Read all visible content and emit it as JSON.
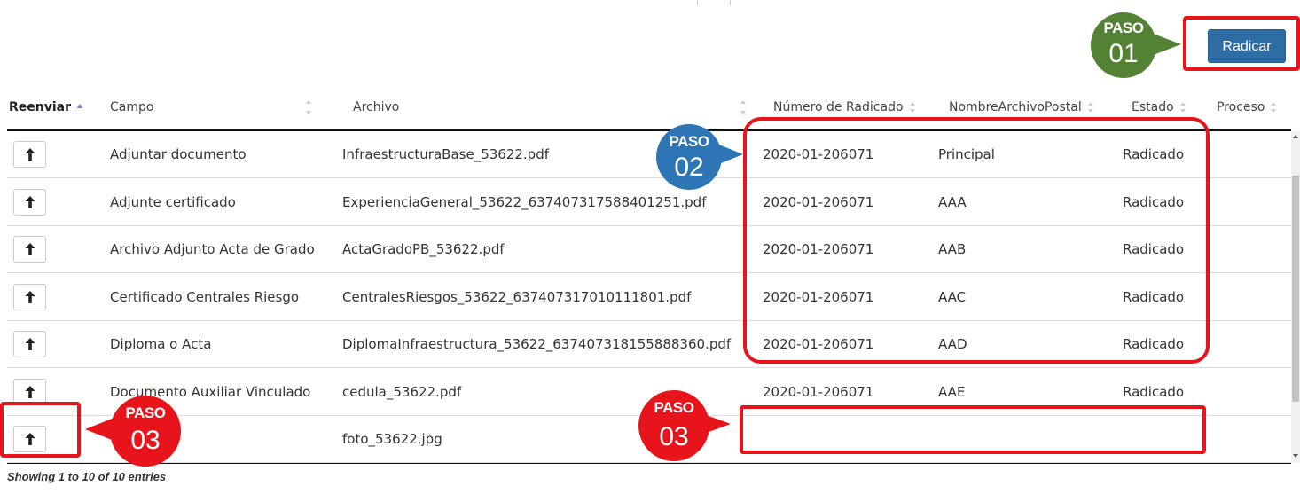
{
  "toolbar": {
    "radicar_label": "Radicar"
  },
  "table": {
    "headers": [
      "Reenviar",
      "Campo",
      "Archivo",
      "Número de Radicado",
      "NombreArchivoPostal",
      "Estado",
      "Proceso"
    ],
    "rows": [
      {
        "campo": "Adjuntar documento",
        "archivo": "InfraestructuraBase_53622.pdf",
        "radicado": "2020-01-206071",
        "postal": "Principal",
        "estado": "Radicado",
        "proceso": ""
      },
      {
        "campo": "Adjunte certificado",
        "archivo": "ExperienciaGeneral_53622_637407317588401251.pdf",
        "radicado": "2020-01-206071",
        "postal": "AAA",
        "estado": "Radicado",
        "proceso": ""
      },
      {
        "campo": "Archivo Adjunto Acta de Grado",
        "archivo": "ActaGradoPB_53622.pdf",
        "radicado": "2020-01-206071",
        "postal": "AAB",
        "estado": "Radicado",
        "proceso": ""
      },
      {
        "campo": "Certificado Centrales Riesgo",
        "archivo": "CentralesRiesgos_53622_637407317010111801.pdf",
        "radicado": "2020-01-206071",
        "postal": "AAC",
        "estado": "Radicado",
        "proceso": ""
      },
      {
        "campo": "Diploma o Acta",
        "archivo": "DiplomaInfraestructura_53622_637407318155888360.pdf",
        "radicado": "2020-01-206071",
        "postal": "AAD",
        "estado": "Radicado",
        "proceso": ""
      },
      {
        "campo": "Documento Auxiliar Vinculado",
        "archivo": "cedula_53622.pdf",
        "radicado": "2020-01-206071",
        "postal": "AAE",
        "estado": "Radicado",
        "proceso": ""
      },
      {
        "campo": "",
        "archivo": "foto_53622.jpg",
        "radicado": "",
        "postal": "",
        "estado": "",
        "proceso": ""
      }
    ]
  },
  "footer": {
    "entries_text": "Showing 1 to 10 of 10 entries"
  },
  "annotations": {
    "step1": {
      "paso": "PASO",
      "num": "01",
      "color": "#548235"
    },
    "step2": {
      "paso": "PASO",
      "num": "02",
      "color": "#2e75b6"
    },
    "step3a": {
      "paso": "PASO",
      "num": "03",
      "color": "#e8141c"
    },
    "step3b": {
      "paso": "PASO",
      "num": "03",
      "color": "#e8141c"
    }
  },
  "icons": {
    "reenviar": "arrow-up-icon",
    "sort": "sort-icon"
  }
}
